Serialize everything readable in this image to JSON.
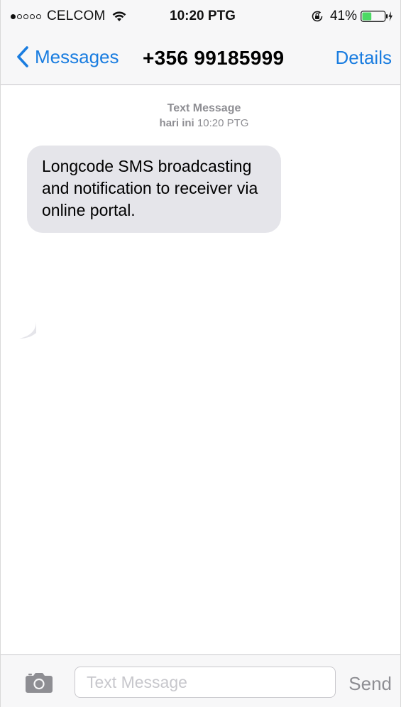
{
  "status_bar": {
    "signal_filled": 1,
    "signal_total": 5,
    "carrier": "CELCOM",
    "time": "10:20 PTG",
    "battery_percent_label": "41%",
    "battery_level": 0.41,
    "icons": [
      "wifi-icon",
      "orientation-lock-icon",
      "battery-icon",
      "charging-bolt-icon"
    ]
  },
  "nav": {
    "back_label": "Messages",
    "title": "+356 99185999",
    "details_label": "Details"
  },
  "conversation": {
    "meta_title": "Text Message",
    "meta_day": "hari ini",
    "meta_time": "10:20 PTG",
    "messages": [
      {
        "direction": "incoming",
        "text": "Longcode SMS broadcasting and notification to receiver via online portal."
      }
    ]
  },
  "input_bar": {
    "placeholder": "Text Message",
    "send_label": "Send",
    "icons": [
      "camera-icon"
    ]
  },
  "colors": {
    "accent": "#1a7de0",
    "bubble_incoming": "#e5e5ea",
    "bar_background": "#f7f7f8",
    "meta_text": "#8e8e93",
    "battery_fill": "#4cd964"
  }
}
